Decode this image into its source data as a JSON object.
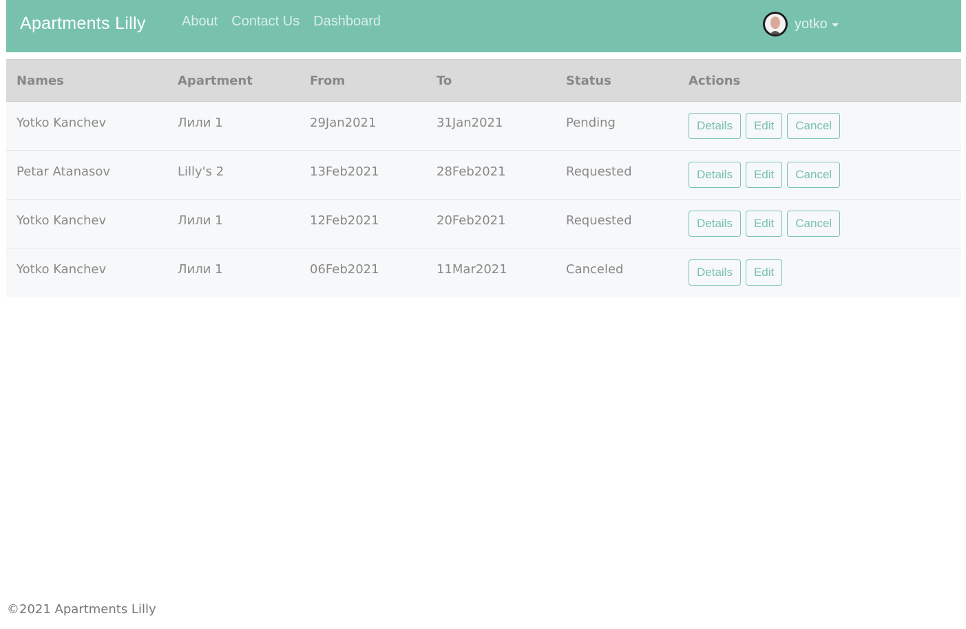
{
  "navbar": {
    "brand": "Apartments Lilly",
    "links": [
      "About",
      "Contact Us",
      "Dashboard"
    ],
    "username": "yotko",
    "accent_color": "#78c2ad"
  },
  "table": {
    "headers": [
      "Names",
      "Apartment",
      "From",
      "To",
      "Status",
      "Actions"
    ],
    "rows": [
      {
        "name": "Yotko Kanchev",
        "apartment": "Лили 1",
        "from": "29Jan2021",
        "to": "31Jan2021",
        "status": "Pending",
        "actions": [
          "Details",
          "Edit",
          "Cancel"
        ]
      },
      {
        "name": "Petar Atanasov",
        "apartment": "Lilly's 2",
        "from": "13Feb2021",
        "to": "28Feb2021",
        "status": "Requested",
        "actions": [
          "Details",
          "Edit",
          "Cancel"
        ]
      },
      {
        "name": "Yotko Kanchev",
        "apartment": "Лили 1",
        "from": "12Feb2021",
        "to": "20Feb2021",
        "status": "Requested",
        "actions": [
          "Details",
          "Edit",
          "Cancel"
        ]
      },
      {
        "name": "Yotko Kanchev",
        "apartment": "Лили 1",
        "from": "06Feb2021",
        "to": "11Mar2021",
        "status": "Canceled",
        "actions": [
          "Details",
          "Edit"
        ]
      }
    ]
  },
  "footer": {
    "text": "©2021 Apartments Lilly"
  }
}
